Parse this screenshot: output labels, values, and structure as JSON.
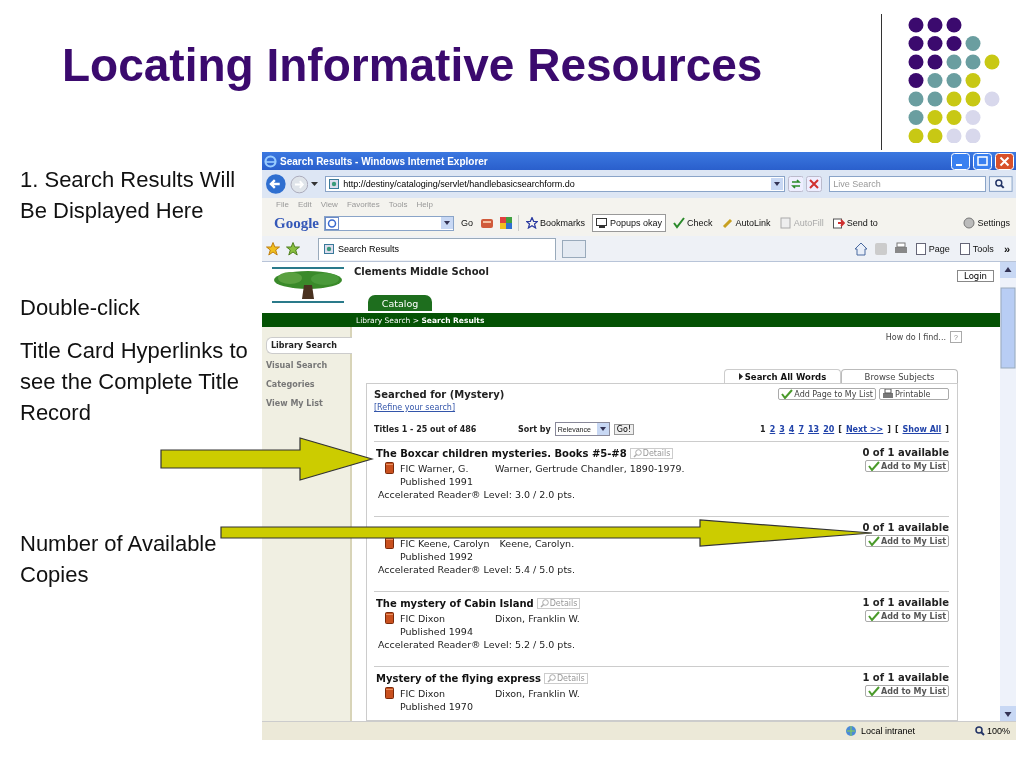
{
  "slide": {
    "title": "Locating Informative Resources",
    "notes": [
      {
        "text": "1. Search Results Will Be Displayed Here"
      },
      {
        "text": "Double-click"
      },
      {
        "text": "Title Card Hyperlinks to see the Complete Title Record"
      },
      {
        "text": "Number of Available Copies"
      }
    ]
  },
  "browser": {
    "title": "Search Results - Windows Internet Explorer",
    "address": "http://destiny/cataloging/servlet/handlebasicsearchform.do",
    "search_placeholder": "Live Search",
    "menu": [
      "File",
      "Edit",
      "View",
      "Favorites",
      "Tools",
      "Help"
    ],
    "google_toolbar": {
      "logo": "Google",
      "go": "Go",
      "items": [
        {
          "kind": "bookmarks",
          "label": "Bookmarks",
          "disabled": false
        },
        {
          "kind": "popups",
          "label": "Popups okay",
          "disabled": false
        },
        {
          "kind": "check",
          "label": "Check",
          "disabled": false
        },
        {
          "kind": "autolink",
          "label": "AutoLink",
          "disabled": false
        },
        {
          "kind": "autofill",
          "label": "AutoFill",
          "disabled": true
        },
        {
          "kind": "sendto",
          "label": "Send to",
          "disabled": false
        }
      ],
      "settings": "Settings"
    },
    "tabs": [
      {
        "label": "Search Results",
        "selected": true
      }
    ],
    "commands": [
      "Page",
      "Tools"
    ],
    "overflow": "»",
    "status": {
      "zone": "Local intranet",
      "zoom": "100%"
    }
  },
  "page": {
    "school": "Clements Middle School",
    "nav_tab": "Catalog",
    "breadcrumb": "Library Search > **Search Results**",
    "login": "Login",
    "sidebar": [
      {
        "label": "Library Search",
        "selected": true
      },
      {
        "label": "Visual Search",
        "selected": false
      },
      {
        "label": "Categories",
        "selected": false
      },
      {
        "label": "View My List",
        "selected": false
      }
    ],
    "help": "How do I find...",
    "help_button": "?",
    "search_tabs": [
      {
        "label": "Search All Words",
        "selected": true
      },
      {
        "label": "Browse Subjects",
        "selected": false
      }
    ],
    "searched_for": "Searched for (Mystery)",
    "refine": "[Refine your search]",
    "add_page": "Add Page to My List",
    "printable": "Printable",
    "count": "Titles 1 - 25 out of 486",
    "sort_label": "Sort by",
    "sort_value": "Relevance",
    "go": "Go!",
    "pages": [
      {
        "label": "1",
        "selected": true
      },
      {
        "label": "2",
        "selected": false
      },
      {
        "label": "3",
        "selected": false
      },
      {
        "label": "4",
        "selected": false
      },
      {
        "label": "7",
        "selected": false
      },
      {
        "label": "13",
        "selected": false
      },
      {
        "label": "20",
        "selected": false
      }
    ],
    "page_links": [
      {
        "kind": "text",
        "text": "["
      },
      {
        "kind": "link",
        "text": "Next >>"
      },
      {
        "kind": "text",
        "text": "]"
      },
      {
        "kind": "text",
        "text": "["
      },
      {
        "kind": "link",
        "text": "Show All"
      },
      {
        "kind": "text",
        "text": "]"
      }
    ],
    "results": [
      {
        "title": "The Boxcar children mysteries. Books #5-#8",
        "details": "Details",
        "call_number": "FIC Warner, G.",
        "author": "Warner, Gertrude Chandler, 1890-1979.",
        "published": "Published 1991",
        "reading_level": "Accelerated Reader® Level:  3.0 / 2.0 pts.",
        "availability": "0 of 1 available",
        "add": "Add to My List"
      },
      {
        "call_number": "FIC Keene, Carolyn",
        "author": "Keene, Carolyn.",
        "published": "Published 1992",
        "reading_level": "Accelerated Reader® Level:  5.4 / 5.0 pts.",
        "availability": "0 of 1 available",
        "add": "Add to My List"
      },
      {
        "title": "The mystery of Cabin Island",
        "details": "Details",
        "call_number": "FIC Dixon",
        "author": "Dixon, Franklin W.",
        "published": "Published 1994",
        "reading_level": "Accelerated Reader® Level:  5.2 / 5.0 pts.",
        "availability": "1 of 1 available",
        "add": "Add to My List"
      },
      {
        "title": "Mystery of the flying express",
        "details": "Details",
        "call_number": "FIC Dixon",
        "author": "Dixon, Franklin W.",
        "published": "Published 1970",
        "availability": "1 of 1 available",
        "add": "Add to My List"
      }
    ]
  }
}
